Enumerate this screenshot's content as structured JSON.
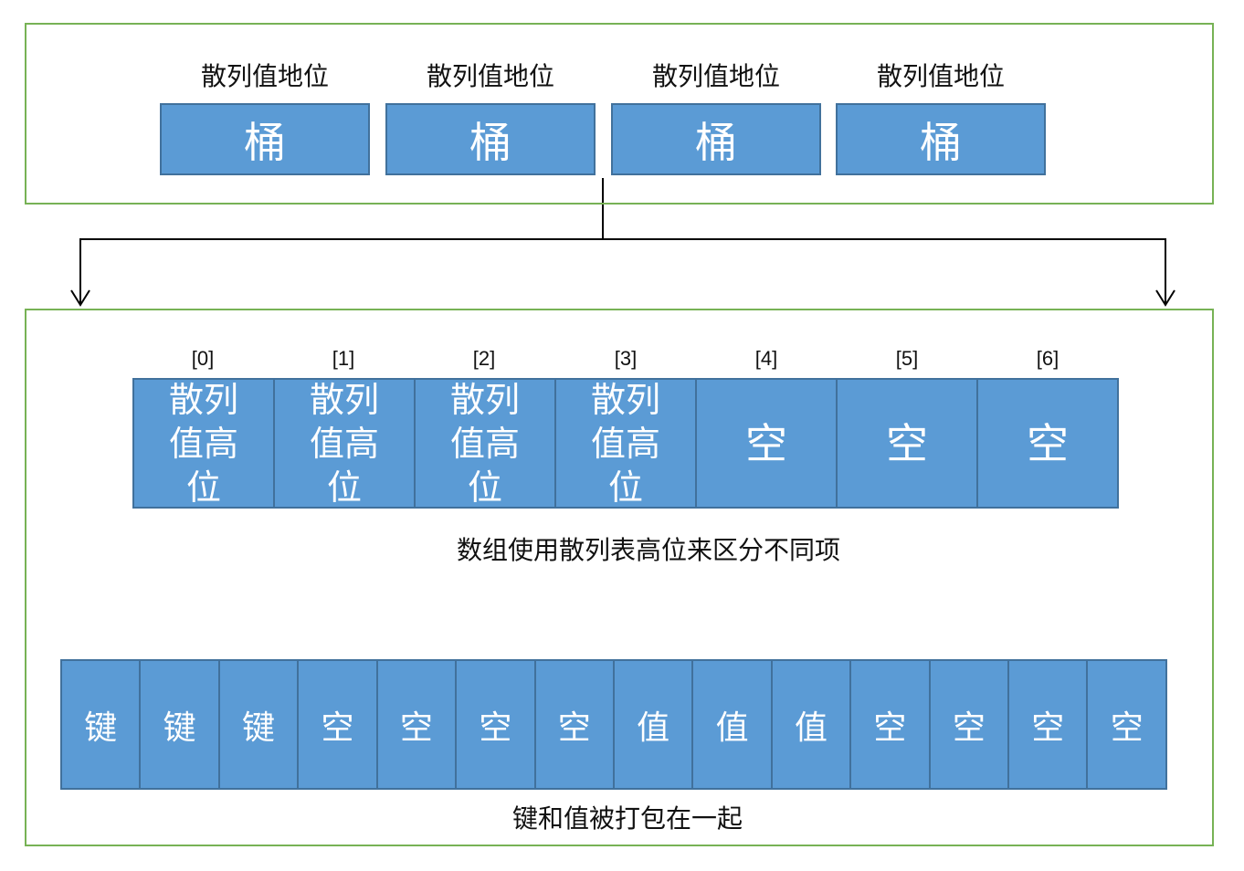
{
  "top_panel": {
    "buckets": [
      {
        "label": "散列值地位",
        "text": "桶"
      },
      {
        "label": "散列值地位",
        "text": "桶"
      },
      {
        "label": "散列值地位",
        "text": "桶"
      },
      {
        "label": "散列值地位",
        "text": "桶"
      }
    ]
  },
  "array": {
    "indices": [
      "[0]",
      "[1]",
      "[2]",
      "[3]",
      "[4]",
      "[5]",
      "[6]"
    ],
    "cells": [
      "散列值高位",
      "散列值高位",
      "散列值高位",
      "散列值高位",
      "空",
      "空",
      "空"
    ],
    "caption": "数组使用散列表高位来区分不同项"
  },
  "packed": {
    "cells": [
      "键",
      "键",
      "键",
      "空",
      "空",
      "空",
      "空",
      "值",
      "值",
      "值",
      "空",
      "空",
      "空",
      "空"
    ],
    "caption": "键和值被打包在一起"
  },
  "colors": {
    "panel_border": "#77b255",
    "cell_fill": "#5b9bd5",
    "cell_border": "#41719c"
  }
}
